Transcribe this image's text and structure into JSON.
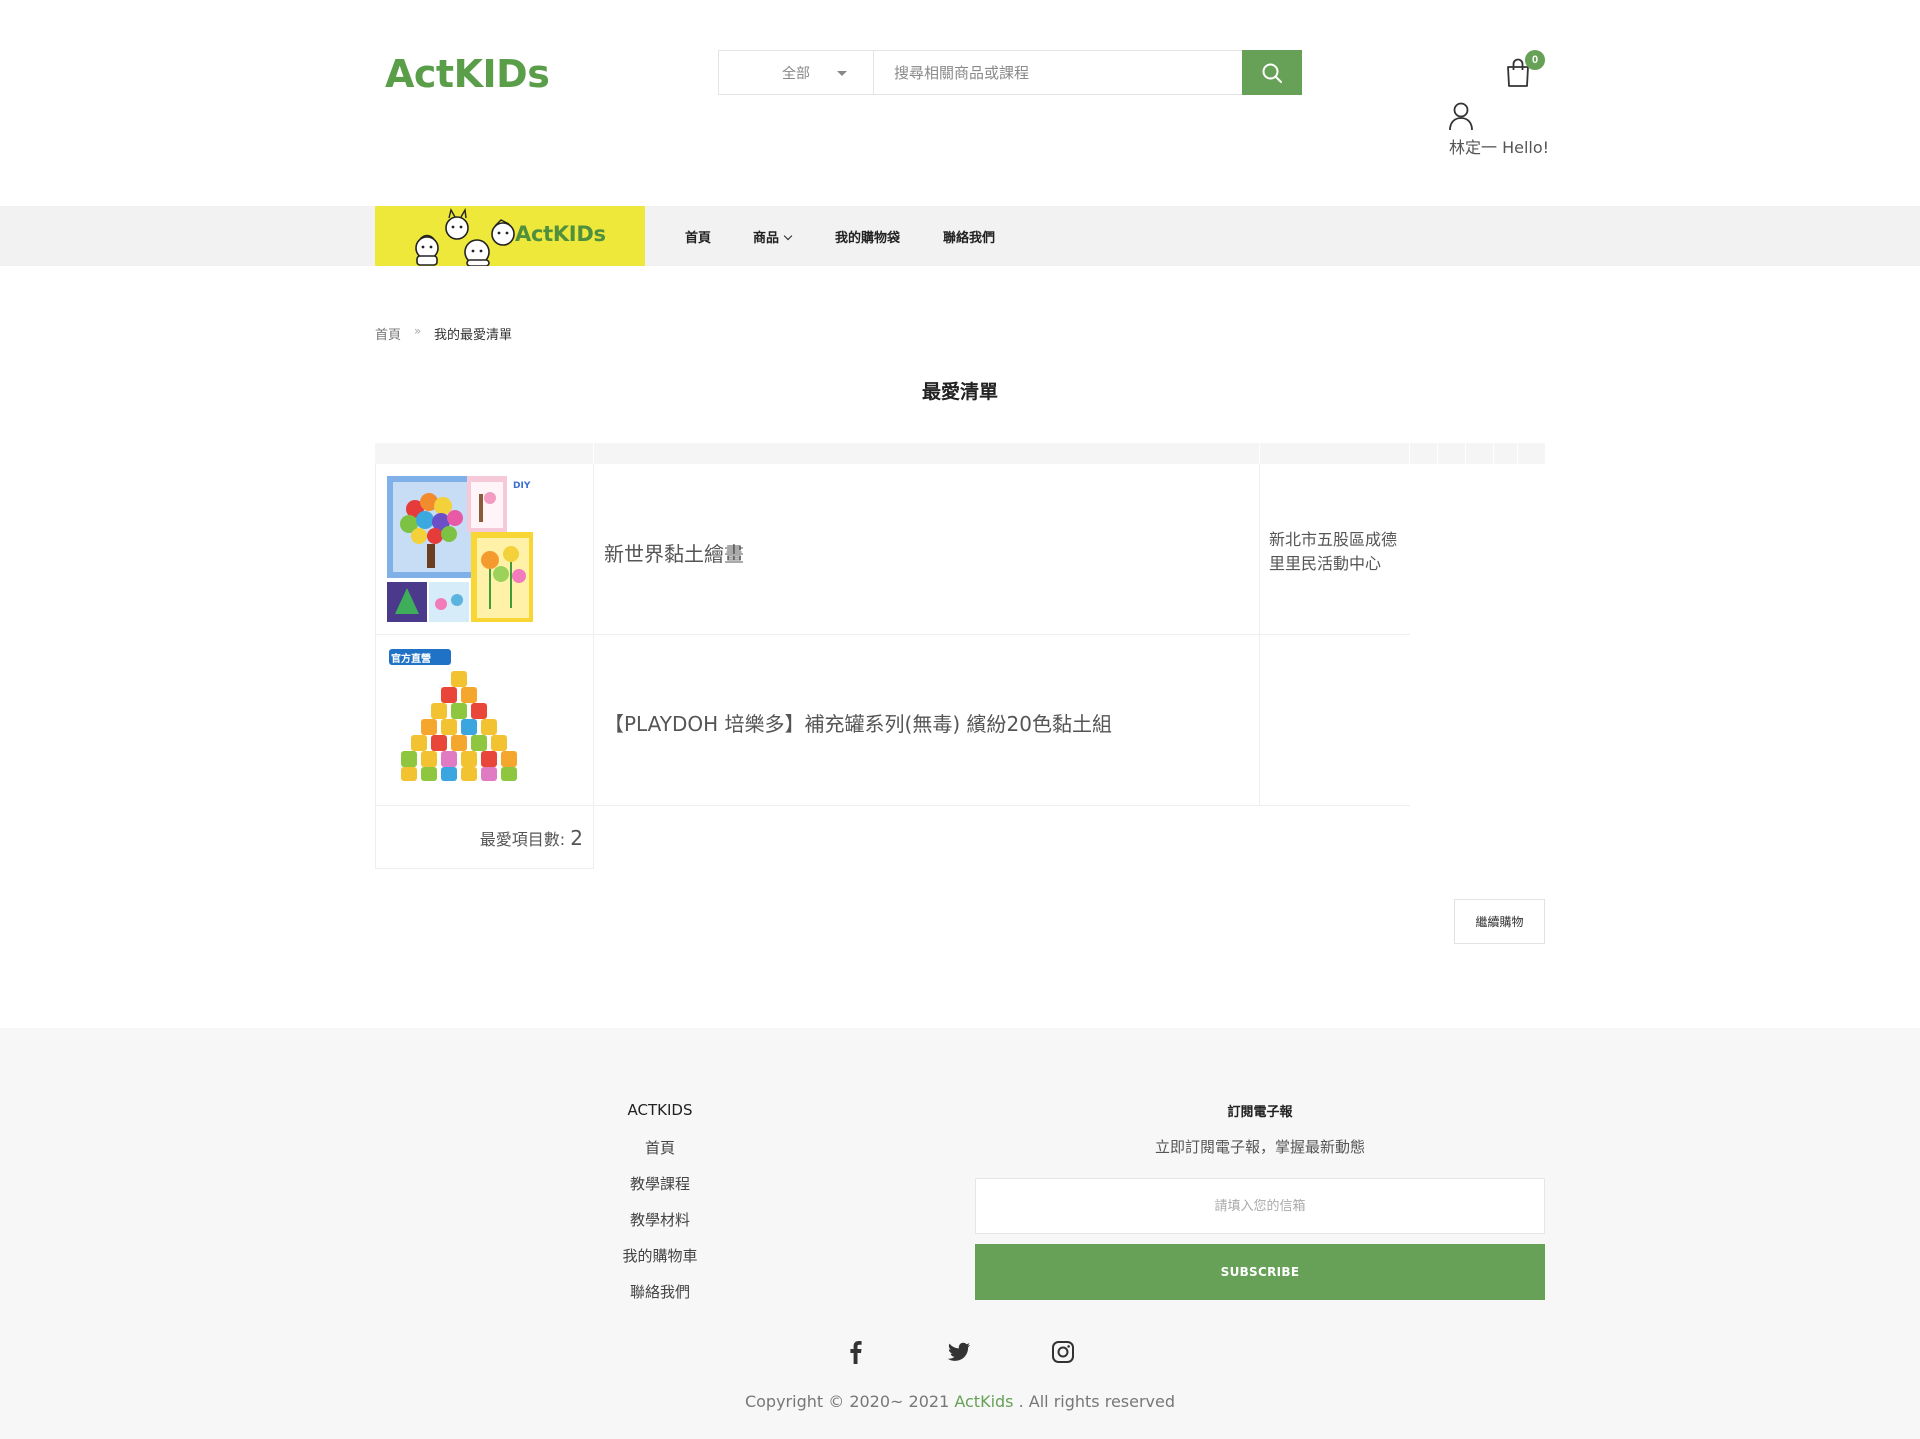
{
  "header": {
    "logo": "ActKIDs",
    "search_category": "全部",
    "search_placeholder": "搜尋相關商品或課程",
    "cart_count": "0",
    "user_greeting": "林定一 Hello!"
  },
  "nav": {
    "banner_text": "ActKIDs",
    "items": [
      {
        "label": "首頁"
      },
      {
        "label": "商品"
      },
      {
        "label": "我的購物袋"
      },
      {
        "label": "聯絡我們"
      }
    ]
  },
  "breadcrumb": {
    "home": "首頁",
    "separator": "»",
    "current": "我的最愛清單"
  },
  "page_title": "最愛清單",
  "wishlist": {
    "items": [
      {
        "name": "新世界黏土繪畫",
        "location": "新北市五股區成德里里民活動中心",
        "image": "clay-painting-product-image"
      },
      {
        "name": "【PLAYDOH 培樂多】補充罐系列(無毒) 繽紛20色黏土組",
        "location": "",
        "image": "playdoh-20-cans-product-image",
        "badge": "官方直營"
      }
    ],
    "count_label": "最愛項目數:",
    "count_value": "2"
  },
  "continue_button": "繼續購物",
  "footer": {
    "col_title": "ACTKIDS",
    "links": [
      "首頁",
      "教學課程",
      "教學材料",
      "我的購物車",
      "聯絡我們"
    ],
    "subscribe_title": "訂閱電子報",
    "subscribe_desc": "立即訂閱電子報，掌握最新動態",
    "email_placeholder": "請填入您的信箱",
    "subscribe_button": "SUBSCRIBE",
    "social": [
      "facebook-icon",
      "twitter-icon",
      "instagram-icon"
    ],
    "copyright_prefix": "Copyright © 2020~ 2021",
    "copyright_brand": "ActKids",
    "copyright_suffix": ". All rights reserved"
  },
  "colors": {
    "accent_green": "#66a157",
    "banner_yellow": "#ede83a"
  }
}
